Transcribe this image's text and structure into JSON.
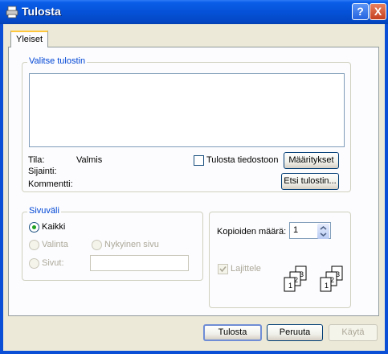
{
  "window": {
    "title": "Tulosta",
    "help_glyph": "?",
    "close_glyph": "X"
  },
  "tabs": [
    {
      "label": "Yleiset"
    }
  ],
  "printer_group": {
    "label": "Valitse tulostin",
    "status_label": "Tila:",
    "status_value": "Valmis",
    "location_label": "Sijainti:",
    "comment_label": "Kommentti:",
    "print_to_file_label": "Tulosta tiedostoon",
    "properties_button": "Määritykset",
    "find_printer_button": "Etsi tulostin..."
  },
  "page_range": {
    "label": "Sivuväli",
    "all_label": "Kaikki",
    "selection_label": "Valinta",
    "current_page_label": "Nykyinen sivu",
    "pages_label": "Sivut:",
    "pages_value": ""
  },
  "copies": {
    "count_label": "Kopioiden määrä:",
    "count_value": "1",
    "collate_label": "Lajittele",
    "collate_icon_digits": [
      "1",
      "2",
      "3"
    ]
  },
  "buttons": {
    "print": "Tulosta",
    "cancel": "Peruuta",
    "apply": "Käytä"
  }
}
